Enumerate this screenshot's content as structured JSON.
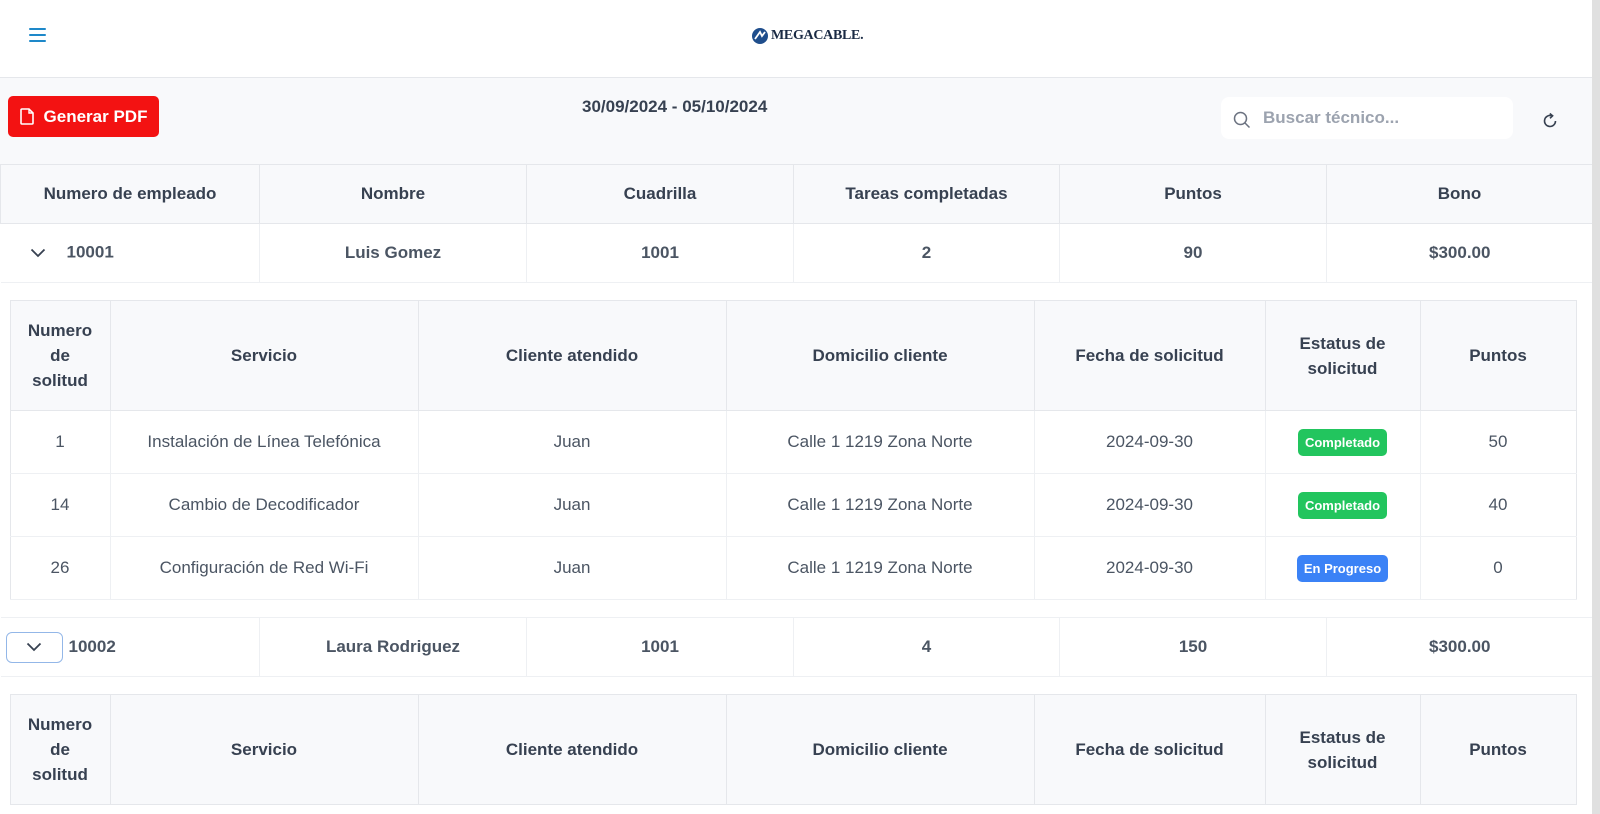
{
  "header": {
    "logo_text": "MEGACABLE."
  },
  "toolbar": {
    "pdf_label": "Generar PDF",
    "date_range": "30/09/2024 - 05/10/2024",
    "search_placeholder": "Buscar técnico..."
  },
  "table": {
    "columns": [
      "Numero de empleado",
      "Nombre",
      "Cuadrilla",
      "Tareas completadas",
      "Puntos",
      "Bono"
    ],
    "rows": [
      {
        "employee": "10001",
        "name": "Luis Gomez",
        "crew": "1001",
        "tasks": "2",
        "points": "90",
        "bonus": "$300.00"
      },
      {
        "employee": "10002",
        "name": "Laura Rodriguez",
        "crew": "1001",
        "tasks": "4",
        "points": "150",
        "bonus": "$300.00"
      }
    ]
  },
  "detail": {
    "columns": [
      "Numero de solitud",
      "Servicio",
      "Cliente atendido",
      "Domicilio cliente",
      "Fecha de solicitud",
      "Estatus de solicitud",
      "Puntos"
    ],
    "rows": [
      {
        "id": "1",
        "service": "Instalación de Línea Telefónica",
        "client": "Juan",
        "address": "Calle 1 1219 Zona Norte",
        "date": "2024-09-30",
        "status": "Completado",
        "points": "50"
      },
      {
        "id": "14",
        "service": "Cambio de Decodificador",
        "client": "Juan",
        "address": "Calle 1 1219 Zona Norte",
        "date": "2024-09-30",
        "status": "Completado",
        "points": "40"
      },
      {
        "id": "26",
        "service": "Configuración de Red Wi-Fi",
        "client": "Juan",
        "address": "Calle 1 1219 Zona Norte",
        "date": "2024-09-30",
        "status": "En Progreso",
        "points": "0"
      }
    ]
  },
  "colors": {
    "accent_red": "#f31212",
    "status_completed": "#22c55e",
    "status_in_progress": "#3b82f6",
    "menu_blue": "#1e88c9"
  }
}
